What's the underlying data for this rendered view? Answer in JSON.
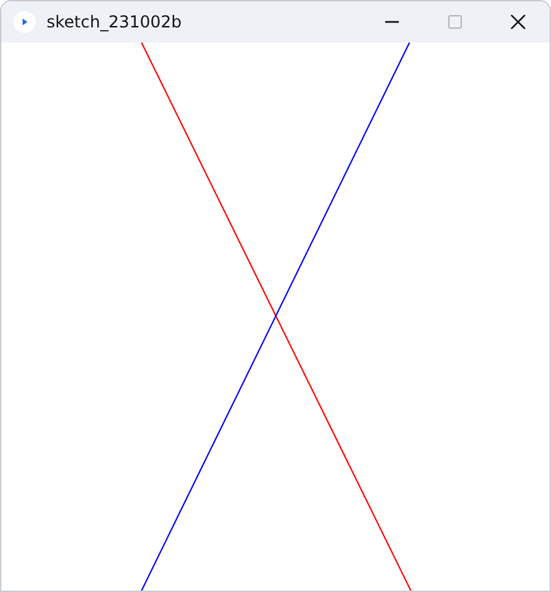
{
  "window": {
    "title": "sketch_231002b"
  },
  "controls": [
    {
      "kind": "minimize",
      "disabled": false
    },
    {
      "kind": "maximize",
      "disabled": true
    },
    {
      "kind": "close",
      "disabled": false
    }
  ]
}
